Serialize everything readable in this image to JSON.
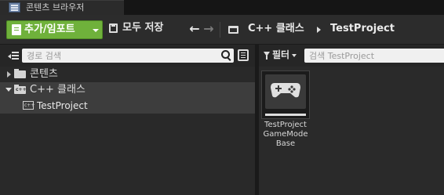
{
  "window": {
    "tab_title": "콘텐츠 브라우저"
  },
  "toolbar": {
    "add_import_label": "추가/임포트",
    "save_all_label": "모두 저장",
    "breadcrumbs": [
      "C++ 클래스",
      "TestProject"
    ]
  },
  "sources_panel": {
    "search_placeholder": "경로 검색",
    "tree": [
      {
        "label": "콘텐츠",
        "expanded": false,
        "icon": "folder-icon"
      },
      {
        "label": "C++ 클래스",
        "expanded": true,
        "icon": "cpp-folder-icon",
        "children": [
          {
            "label": "TestProject",
            "icon": "cpp-class-icon"
          }
        ]
      }
    ]
  },
  "asset_panel": {
    "filter_label": "필터",
    "search_placeholder": "검색 TestProject",
    "assets": [
      {
        "name_lines": [
          "TestProject",
          "GameMode",
          "Base"
        ],
        "icon": "gamepad-icon"
      }
    ]
  },
  "colors": {
    "add_button": "#6fb13b",
    "background": "#1d1d1d",
    "panel": "#292929"
  }
}
